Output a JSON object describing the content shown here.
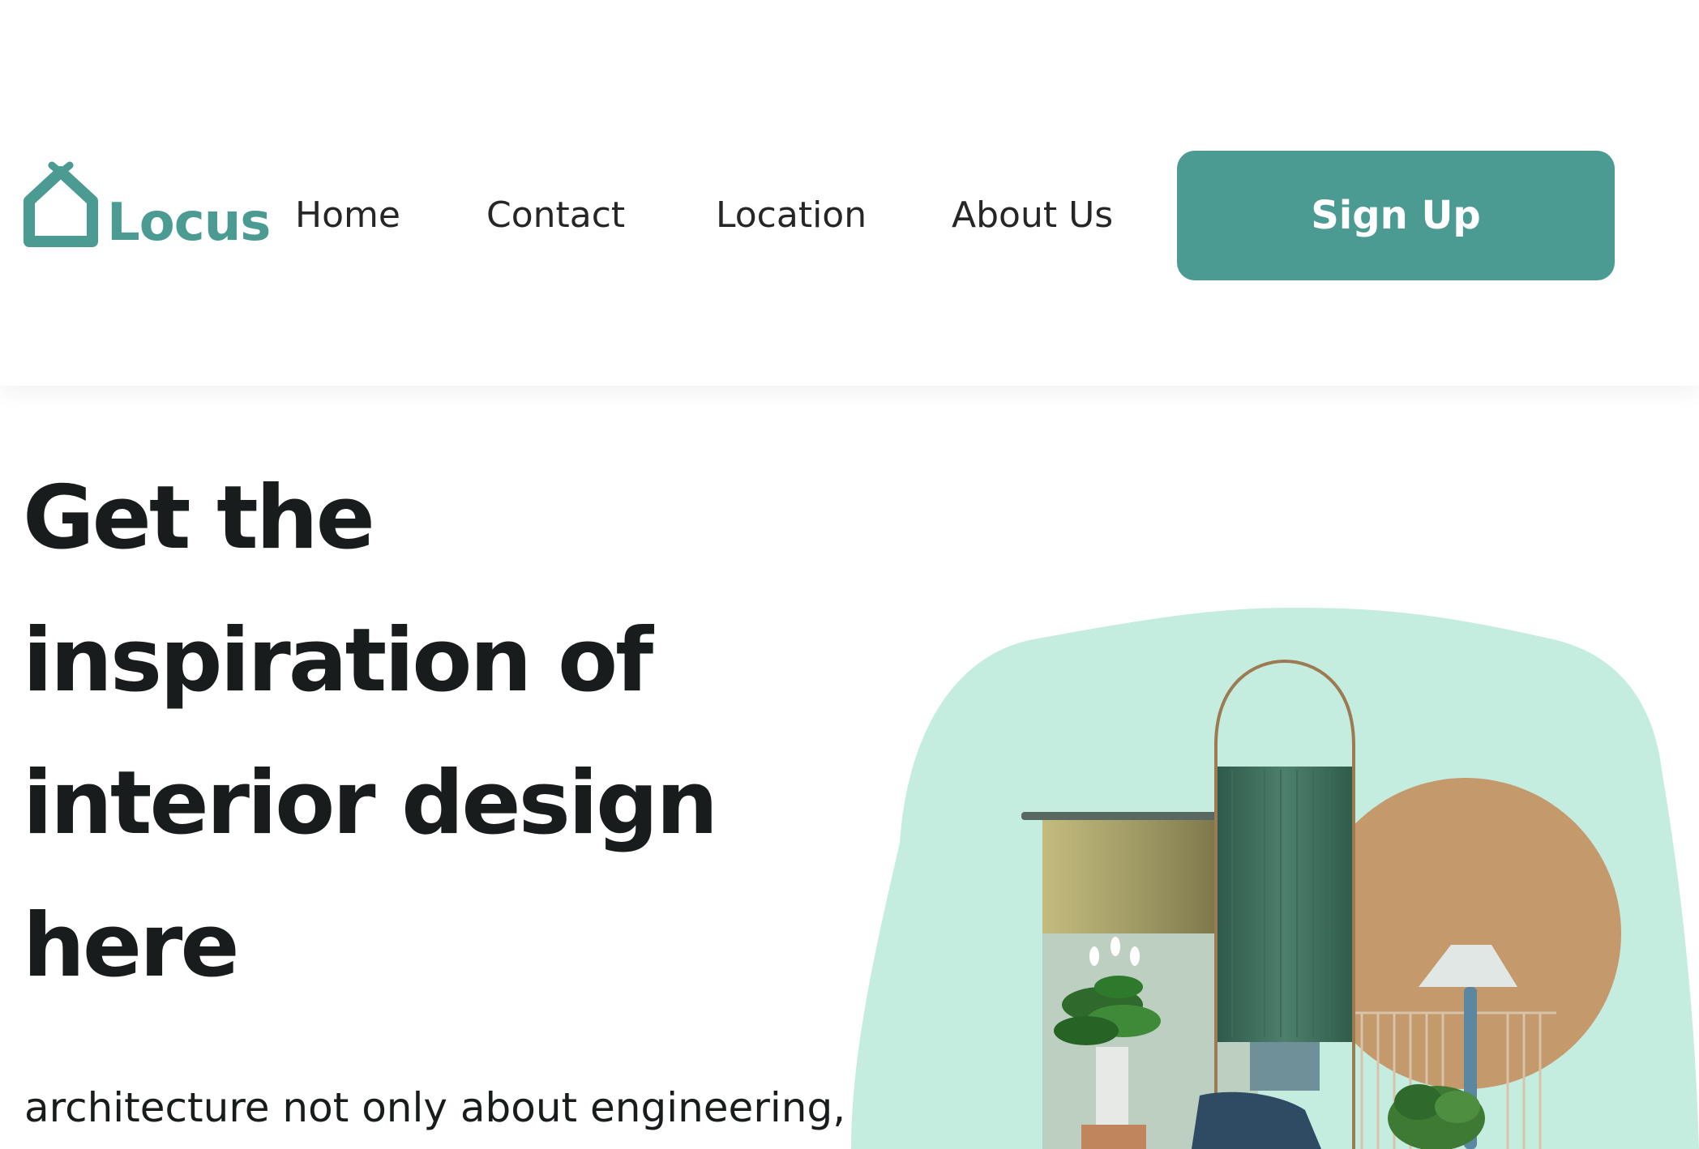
{
  "brand": {
    "name": "Locus",
    "color": "#4b9b93"
  },
  "nav": {
    "links": [
      {
        "label": "Home"
      },
      {
        "label": "Contact"
      },
      {
        "label": "Location"
      },
      {
        "label": "About Us"
      }
    ],
    "cta_label": "Sign Up"
  },
  "hero": {
    "title": "Get the inspiration of interior design here",
    "subtitle": "architecture not only about engineering,",
    "illustration_icon": "interior-design-illustration",
    "blob_color": "#c4ede0"
  }
}
